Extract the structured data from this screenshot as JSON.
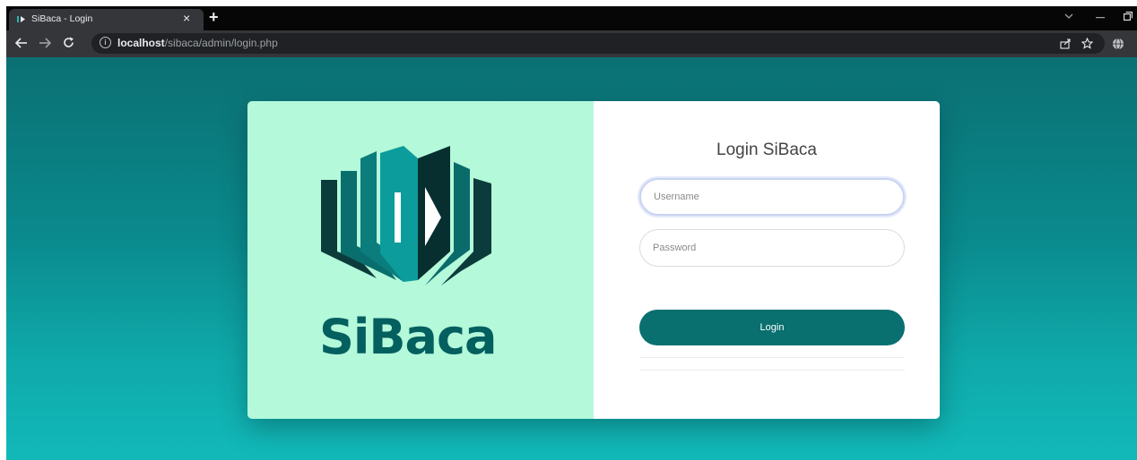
{
  "browser": {
    "tab_title": "SiBaca - Login",
    "tab_close": "×",
    "new_tab": "+",
    "url_host": "localhost",
    "url_path": "/sibaca/admin/login.php",
    "info_glyph": "i"
  },
  "page": {
    "brand_name": "SiBaca",
    "login_title": "Login SiBaca",
    "username_placeholder": "Username",
    "password_placeholder": "Password",
    "login_button": "Login"
  },
  "colors": {
    "left_panel": "#b3f9da",
    "brand_dark": "#045f5f",
    "button": "#096f6f",
    "bg_top": "#0b7073",
    "bg_bottom": "#12b9b9"
  },
  "icons": [
    "back-icon",
    "forward-icon",
    "reload-icon",
    "info-icon",
    "share-icon",
    "star-icon",
    "extension-icons",
    "puzzle-icon",
    "sidebar-icon"
  ]
}
